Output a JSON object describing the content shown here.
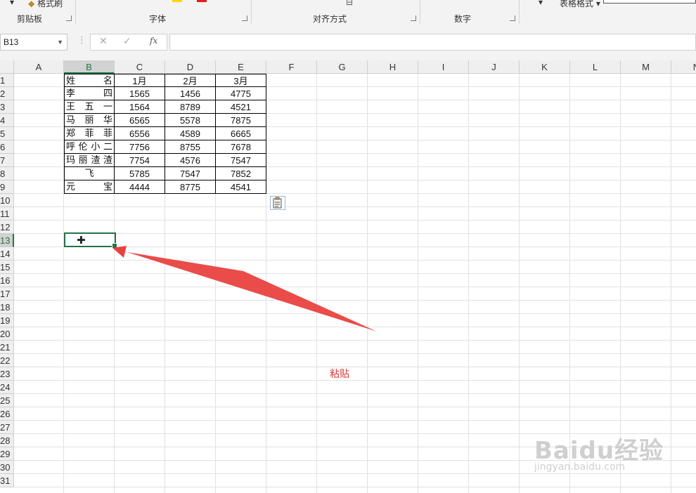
{
  "ribbon": {
    "groups": [
      {
        "label": "剪贴板"
      },
      {
        "label": "字体"
      },
      {
        "label": "对齐方式"
      },
      {
        "label": "数字"
      }
    ],
    "format_painter_label": "格式刷",
    "table_format_label": "表格格式"
  },
  "formula_bar": {
    "name_box": "B13",
    "cancel_icon": "✕",
    "enter_icon": "✓",
    "fx_label": "fx",
    "formula": ""
  },
  "sheet": {
    "columns": [
      "A",
      "B",
      "C",
      "D",
      "E",
      "F",
      "G",
      "H",
      "I",
      "J",
      "K",
      "L",
      "M",
      "N"
    ],
    "rows": [
      "1",
      "2",
      "3",
      "4",
      "5",
      "6",
      "7",
      "8",
      "9",
      "10",
      "11",
      "12",
      "13",
      "14",
      "15",
      "16",
      "17",
      "18",
      "19",
      "20",
      "21",
      "22",
      "23",
      "24",
      "25",
      "26",
      "27",
      "28",
      "29",
      "30",
      "31"
    ],
    "selected_cell": "B13",
    "table": {
      "header": {
        "name": "姓　　名",
        "c": "1月",
        "d": "2月",
        "e": "3月"
      },
      "rows": [
        {
          "name": "李　　四",
          "c": "1565",
          "d": "1456",
          "e": "4775"
        },
        {
          "name": "王　五　一",
          "c": "1564",
          "d": "8789",
          "e": "4521"
        },
        {
          "name": "马　丽　华",
          "c": "6565",
          "d": "5578",
          "e": "7875"
        },
        {
          "name": "郑　菲　菲",
          "c": "6556",
          "d": "4589",
          "e": "6665"
        },
        {
          "name": "呼伦小二",
          "c": "7756",
          "d": "8755",
          "e": "7678"
        },
        {
          "name": "玛丽渣渣",
          "c": "7754",
          "d": "4576",
          "e": "7547"
        },
        {
          "name": "飞",
          "c": "5785",
          "d": "7547",
          "e": "7852"
        },
        {
          "name": "元　　宝",
          "c": "4444",
          "d": "8775",
          "e": "4541"
        }
      ]
    }
  },
  "annotation": {
    "text": "粘贴",
    "arrow_color": "#e8423f"
  },
  "watermark": {
    "brand": "Baidu经验",
    "url": "jingyan.baidu.com"
  },
  "colors": {
    "accent": "#217346",
    "grid": "#e1e1e1",
    "header_bg": "#efefef"
  }
}
